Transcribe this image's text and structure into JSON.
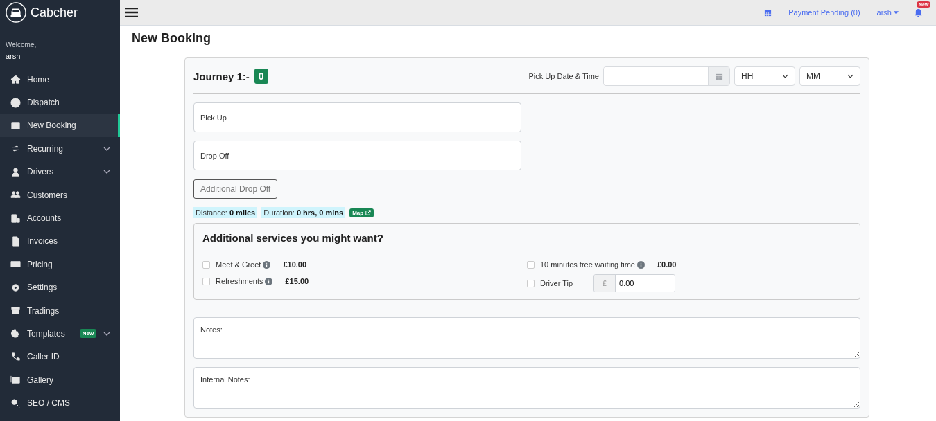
{
  "brand": {
    "name": "Cabcher"
  },
  "sidebar": {
    "welcome": "Welcome,",
    "user": "arsh",
    "items": [
      {
        "label": "Home",
        "selected": false,
        "expandable": false
      },
      {
        "label": "Dispatch",
        "selected": false,
        "expandable": false
      },
      {
        "label": "New Booking",
        "selected": true,
        "expandable": false
      },
      {
        "label": "Recurring",
        "selected": false,
        "expandable": true
      },
      {
        "label": "Drivers",
        "selected": false,
        "expandable": true
      },
      {
        "label": "Customers",
        "selected": false,
        "expandable": false
      },
      {
        "label": "Accounts",
        "selected": false,
        "expandable": false
      },
      {
        "label": "Invoices",
        "selected": false,
        "expandable": false
      },
      {
        "label": "Pricing",
        "selected": false,
        "expandable": false
      },
      {
        "label": "Settings",
        "selected": false,
        "expandable": false
      },
      {
        "label": "Tradings",
        "selected": false,
        "expandable": false
      },
      {
        "label": "Templates",
        "selected": false,
        "expandable": true,
        "badge": "New"
      },
      {
        "label": "Caller ID",
        "selected": false,
        "expandable": false
      },
      {
        "label": "Gallery",
        "selected": false,
        "expandable": false
      },
      {
        "label": "SEO / CMS",
        "selected": false,
        "expandable": false
      }
    ]
  },
  "topbar": {
    "payment_pending": "Payment Pending (0)",
    "user": "arsh",
    "notification_badge": "New"
  },
  "page_title": "New Booking",
  "journey": {
    "title": "Journey 1:-",
    "count": "0",
    "datetime_label": "Pick Up Date & Time",
    "hour_select": "HH",
    "minute_select": "MM",
    "pickup": {
      "placeholder": "Pick Up"
    },
    "dropoff": {
      "placeholder": "Drop Off"
    },
    "additional_drop_button": "Additional Drop Off",
    "distance": {
      "label": "Distance:",
      "value": "0 miles"
    },
    "duration": {
      "label": "Duration:",
      "value": "0 hrs, 0 mins"
    },
    "map_button": "Map"
  },
  "services": {
    "title": "Additional services you might want?",
    "columns": [
      [
        {
          "kind": "price",
          "label": "Meet & Greet",
          "info": true,
          "price": "£10.00",
          "checked": false
        },
        {
          "kind": "price",
          "label": "Refreshments",
          "info": true,
          "price": "£15.00",
          "checked": false
        }
      ],
      [
        {
          "kind": "price",
          "label": "10 minutes free waiting time",
          "info": true,
          "price": "£0.00",
          "checked": false
        },
        {
          "kind": "tip",
          "label": "Driver Tip",
          "info": false,
          "currency": "£",
          "value": "0.00",
          "checked": false
        }
      ]
    ]
  },
  "notes": {
    "placeholder": "Notes:"
  },
  "internal_notes": {
    "placeholder": "Internal Notes:"
  }
}
